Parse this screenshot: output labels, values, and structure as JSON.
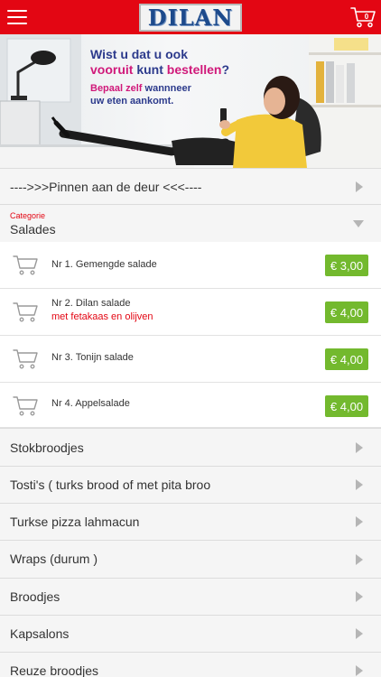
{
  "header": {
    "logo_text": "DILAN",
    "cart_count": "0",
    "brand_color": "#e30613"
  },
  "banner": {
    "line1": "Wist u dat u ook",
    "line2_a": "vooruit ",
    "line2_b": "kunt ",
    "line2_c": "bestellen",
    "line2_d": "?",
    "line3_a": "Bepaal zelf ",
    "line3_b": "wannneer",
    "line4": "uw eten aankomt."
  },
  "payment_row": {
    "label": "---->>>Pinnen aan de deur <<<----"
  },
  "category": {
    "label": "Categorie",
    "value": "Salades"
  },
  "products": [
    {
      "name": "Nr 1. Gemengde salade",
      "note": "",
      "price": "€ 3,00"
    },
    {
      "name": "Nr 2. Dilan salade",
      "note": "met fetakaas en olijven",
      "price": "€ 4,00"
    },
    {
      "name": "Nr 3. Tonijn salade",
      "note": "",
      "price": "€ 4,00"
    },
    {
      "name": "Nr 4. Appelsalade",
      "note": "",
      "price": "€ 4,00"
    }
  ],
  "categories": [
    {
      "label": "Stokbroodjes"
    },
    {
      "label": "Tosti's ( turks brood of met pita broo"
    },
    {
      "label": "Turkse pizza lahmacun"
    },
    {
      "label": "Wraps (durum )"
    },
    {
      "label": "Broodjes"
    },
    {
      "label": "Kapsalons"
    },
    {
      "label": "Reuze broodjes"
    }
  ],
  "colors": {
    "price_green": "#73b92e",
    "accent_magenta": "#d0197a",
    "text_navy": "#2c3a8c"
  },
  "icons": [
    "hamburger-menu-icon",
    "shopping-cart-icon",
    "add-to-cart-icon",
    "chevron-right-icon",
    "chevron-down-icon"
  ]
}
